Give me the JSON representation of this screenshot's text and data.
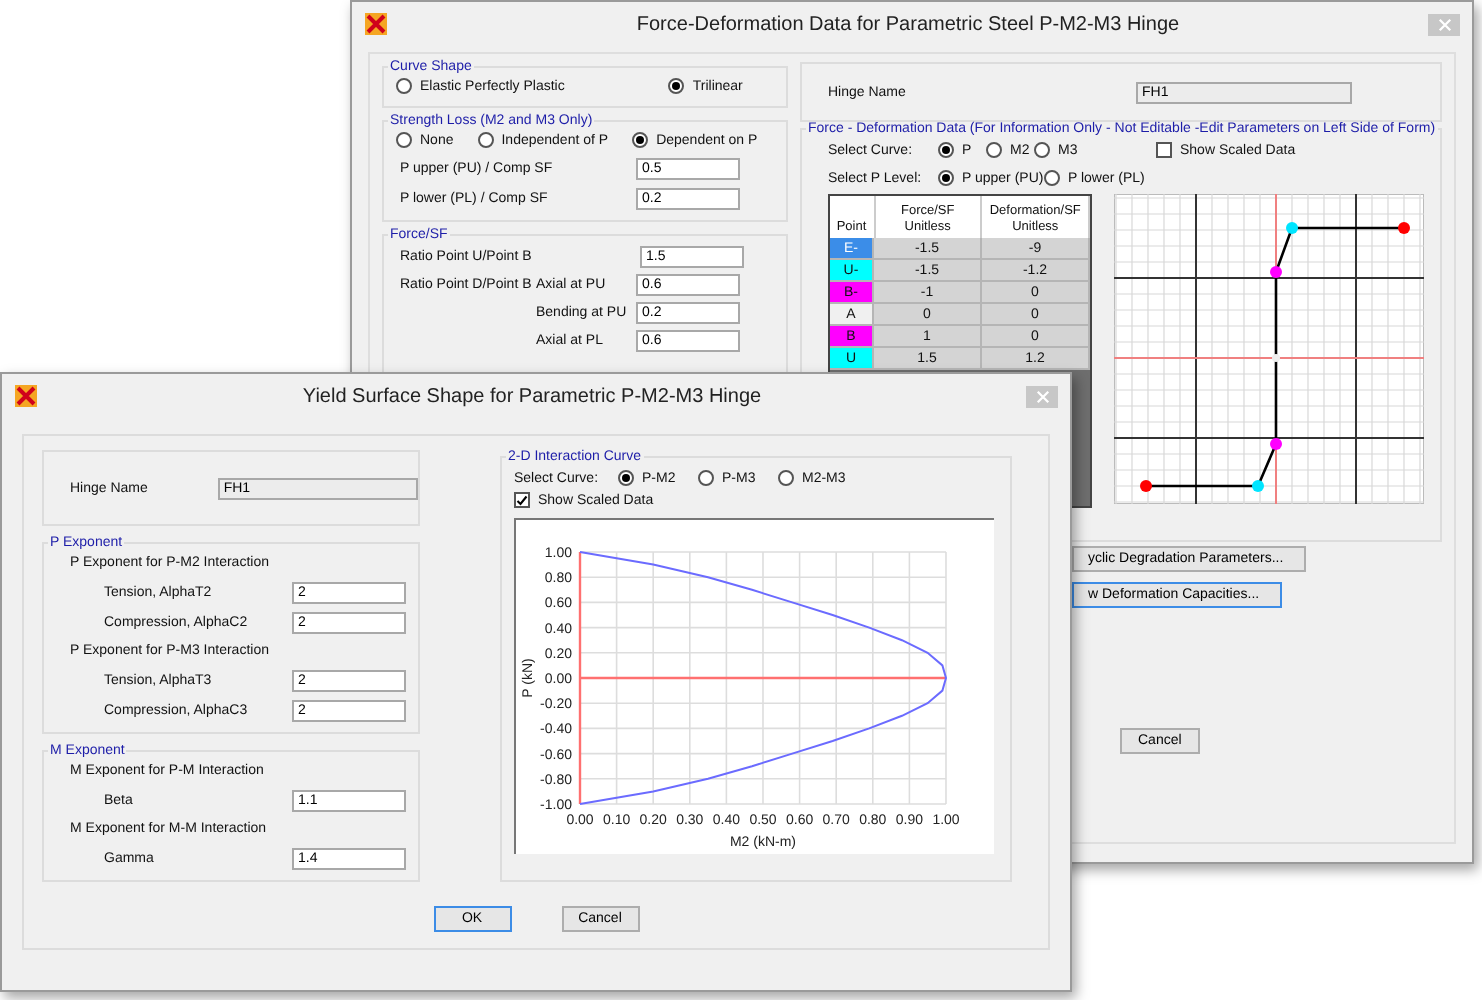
{
  "back_window": {
    "title": "Force-Deformation Data for Parametric Steel P-M2-M3 Hinge",
    "curve_shape": {
      "title": "Curve Shape",
      "options": [
        {
          "label": "Elastic Perfectly Plastic",
          "selected": false
        },
        {
          "label": "Trilinear",
          "selected": true
        }
      ]
    },
    "strength_loss": {
      "title": "Strength Loss  (M2 and M3 Only)",
      "options": [
        {
          "label": "None",
          "selected": false
        },
        {
          "label": "Independent of P",
          "selected": false
        },
        {
          "label": "Dependent on P",
          "selected": true
        }
      ],
      "fields": [
        {
          "label": "P upper (PU) / Comp SF",
          "value": "0.5"
        },
        {
          "label": "P lower (PL) / Comp SF",
          "value": "0.2"
        }
      ]
    },
    "force_sf": {
      "title": "Force/SF",
      "rows": [
        {
          "label": "Ratio Point U/Point B",
          "value": "1.5"
        },
        {
          "label": "Ratio Point D/Point B",
          "sublabel": "Axial at PU",
          "value": "0.6"
        },
        {
          "sublabel": "Bending at PU",
          "value": "0.2"
        },
        {
          "sublabel": "Axial at PL",
          "value": "0.6"
        }
      ]
    },
    "hinge_name": {
      "label": "Hinge Name",
      "value": "FH1"
    },
    "fd_data": {
      "title": "Force - Deformation Data  (For Information Only - Not Editable -Edit Parameters on Left Side of Form)",
      "select_curve": {
        "label": "Select Curve:",
        "options": [
          {
            "label": "P",
            "selected": true
          },
          {
            "label": "M2",
            "selected": false
          },
          {
            "label": "M3",
            "selected": false
          }
        ]
      },
      "show_scaled": {
        "label": "Show Scaled Data",
        "checked": false
      },
      "select_p_level": {
        "label": "Select P Level:",
        "options": [
          {
            "label": "P upper  (PU)",
            "selected": true
          },
          {
            "label": "P lower  (PL)",
            "selected": false
          }
        ]
      },
      "table": {
        "columns": [
          [
            "Point"
          ],
          [
            "Force/SF",
            "Unitless"
          ],
          [
            "Deformation/SF",
            "Unitless"
          ]
        ],
        "rows": [
          {
            "point": "E-",
            "color": "#3b8de8",
            "force": "-1.5",
            "deformation": "-9"
          },
          {
            "point": "U-",
            "color": "#00ffff",
            "force": "-1.5",
            "deformation": "-1.2"
          },
          {
            "point": "B-",
            "color": "#ff00ff",
            "force": "-1",
            "deformation": "0"
          },
          {
            "point": "A",
            "color": "#f0f0f0",
            "force": "0",
            "deformation": "0"
          },
          {
            "point": "B",
            "color": "#ff00ff",
            "force": "1",
            "deformation": "0"
          },
          {
            "point": "U",
            "color": "#00ffff",
            "force": "1.5",
            "deformation": "1.2"
          }
        ]
      }
    },
    "buttons": [
      "yclic Degradation Parameters...",
      "w Deformation Capacities..."
    ],
    "cancel": "Cancel"
  },
  "front_window": {
    "title": "Yield Surface Shape for Parametric P-M2-M3 Hinge",
    "hinge_name": {
      "label": "Hinge Name",
      "value": "FH1"
    },
    "p_exponent": {
      "title": "P Exponent",
      "groups": [
        {
          "title": "P Exponent for P-M2 Interaction",
          "fields": [
            {
              "label": "Tension,  AlphaT2",
              "value": "2"
            },
            {
              "label": "Compression,  AlphaC2",
              "value": "2"
            }
          ]
        },
        {
          "title": "P Exponent for P-M3 Interaction",
          "fields": [
            {
              "label": "Tension,  AlphaT3",
              "value": "2"
            },
            {
              "label": "Compression,  AlphaC3",
              "value": "2"
            }
          ]
        }
      ]
    },
    "m_exponent": {
      "title": "M Exponent",
      "groups": [
        {
          "title": "M Exponent for P-M Interaction",
          "fields": [
            {
              "label": "Beta",
              "value": "1.1"
            }
          ]
        },
        {
          "title": "M Exponent for M-M Interaction",
          "fields": [
            {
              "label": "Gamma",
              "value": "1.4"
            }
          ]
        }
      ]
    },
    "curve": {
      "title": "2-D Interaction Curve",
      "select_curve": {
        "label": "Select Curve:",
        "options": [
          {
            "label": "P-M2",
            "selected": true
          },
          {
            "label": "P-M3",
            "selected": false
          },
          {
            "label": "M2-M3",
            "selected": false
          }
        ]
      },
      "show_scaled": {
        "label": "Show Scaled Data",
        "checked": true
      },
      "chart_data": {
        "type": "line",
        "xlabel": "M2 (kN-m)",
        "ylabel": "P (kN)",
        "x": [
          0,
          0.2,
          0.35,
          0.47,
          0.58,
          0.69,
          0.79,
          0.88,
          0.95,
          0.99,
          1.0,
          0.99,
          0.95,
          0.88,
          0.79,
          0.69,
          0.58,
          0.47,
          0.35,
          0.2,
          0
        ],
        "grid": true,
        "ref_lines": [
          {
            "axis": "y",
            "value": 0,
            "color": "#ff7070"
          }
        ],
        "series": [
          {
            "color": "#6b6bff",
            "values": [
              1,
              0.9,
              0.8,
              0.7,
              0.6,
              0.5,
              0.4,
              0.3,
              0.2,
              0.1,
              0,
              -0.1,
              -0.2,
              -0.3,
              -0.4,
              -0.5,
              -0.6,
              -0.7,
              -0.8,
              -0.9,
              -1
            ]
          }
        ],
        "xlim": [
          0,
          1
        ],
        "ylim": [
          -1,
          1
        ],
        "xticks": [
          {
            "value": 0,
            "label": "0.00"
          },
          {
            "value": 0.1,
            "label": "0.10"
          },
          {
            "value": 0.2,
            "label": "0.20"
          },
          {
            "value": 0.3,
            "label": "0.30"
          },
          {
            "value": 0.4,
            "label": "0.40"
          },
          {
            "value": 0.5,
            "label": "0.50"
          },
          {
            "value": 0.6,
            "label": "0.60"
          },
          {
            "value": 0.7,
            "label": "0.70"
          },
          {
            "value": 0.8,
            "label": "0.80"
          },
          {
            "value": 0.9,
            "label": "0.90"
          },
          {
            "value": 1,
            "label": "1.00"
          }
        ],
        "yticks": [
          {
            "value": 1,
            "label": "1.00"
          },
          {
            "value": 0.8,
            "label": "0.80"
          },
          {
            "value": 0.6,
            "label": "0.60"
          },
          {
            "value": 0.4,
            "label": "0.40"
          },
          {
            "value": 0.2,
            "label": "0.20"
          },
          {
            "value": 0,
            "label": "0.00"
          },
          {
            "value": -0.2,
            "label": "-0.20"
          },
          {
            "value": -0.4,
            "label": "-0.40"
          },
          {
            "value": -0.6,
            "label": "-0.60"
          },
          {
            "value": -0.8,
            "label": "-0.80"
          },
          {
            "value": -1,
            "label": "-1.00"
          }
        ]
      }
    },
    "buttons": [
      "OK",
      "Cancel"
    ]
  }
}
